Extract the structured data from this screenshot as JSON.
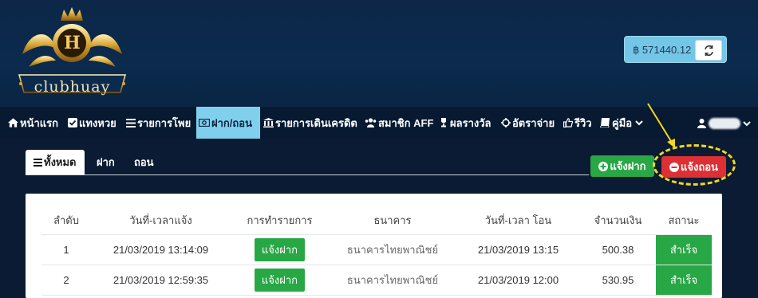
{
  "brand": {
    "name": "clubhuay",
    "monogram": "H"
  },
  "credit": {
    "value": "฿ 571440.12"
  },
  "nav": {
    "items": [
      {
        "label": "หน้าแรก",
        "icon": "home-icon"
      },
      {
        "label": "แทงหวย",
        "icon": "checkbox-icon"
      },
      {
        "label": "รายการโพย",
        "icon": "list-icon"
      },
      {
        "label": "ฝาก/ถอน",
        "icon": "money-icon",
        "active": true
      },
      {
        "label": "รายการเดินเครดิต",
        "icon": "bank-icon"
      },
      {
        "label": "สมาชิก AFF",
        "icon": "users-icon"
      },
      {
        "label": "ผลรางวัล",
        "icon": "trophy-icon"
      },
      {
        "label": "อัตราจ่าย",
        "icon": "crosshair-icon"
      },
      {
        "label": "รีวิว",
        "icon": "thumbs-up-icon"
      },
      {
        "label": "คู่มือ",
        "icon": "book-icon"
      }
    ]
  },
  "tabs": [
    {
      "label": "ทั้งหมด",
      "active": true
    },
    {
      "label": "ฝาก"
    },
    {
      "label": "ถอน"
    }
  ],
  "actions": {
    "deposit_label": "แจ้งฝาก",
    "withdraw_label": "แจ้งถอน"
  },
  "table": {
    "headers": [
      "ลำดับ",
      "วันที่-เวลาแจ้ง",
      "การทำรายการ",
      "ธนาคาร",
      "วันที่-เวลา โอน",
      "จำนวนเงิน",
      "สถานะ"
    ],
    "rows": [
      {
        "no": "1",
        "reported": "21/03/2019 13:14:09",
        "type": "แจ้งฝาก",
        "bank": "ธนาคารไทยพาณิชย์",
        "transferred": "21/03/2019 13:15",
        "amount": "500.38",
        "status": "สำเร็จ"
      },
      {
        "no": "2",
        "reported": "21/03/2019 12:59:35",
        "type": "แจ้งฝาก",
        "bank": "ธนาคารไทยพาณิชย์",
        "transferred": "21/03/2019 12:00",
        "amount": "530.95",
        "status": "สำเร็จ"
      }
    ]
  },
  "colors": {
    "header_bg": "#0b2a4d",
    "nav_active": "#7fd0ec",
    "deposit": "#28a745",
    "withdraw": "#dc3035",
    "highlight": "#f3d91d"
  }
}
